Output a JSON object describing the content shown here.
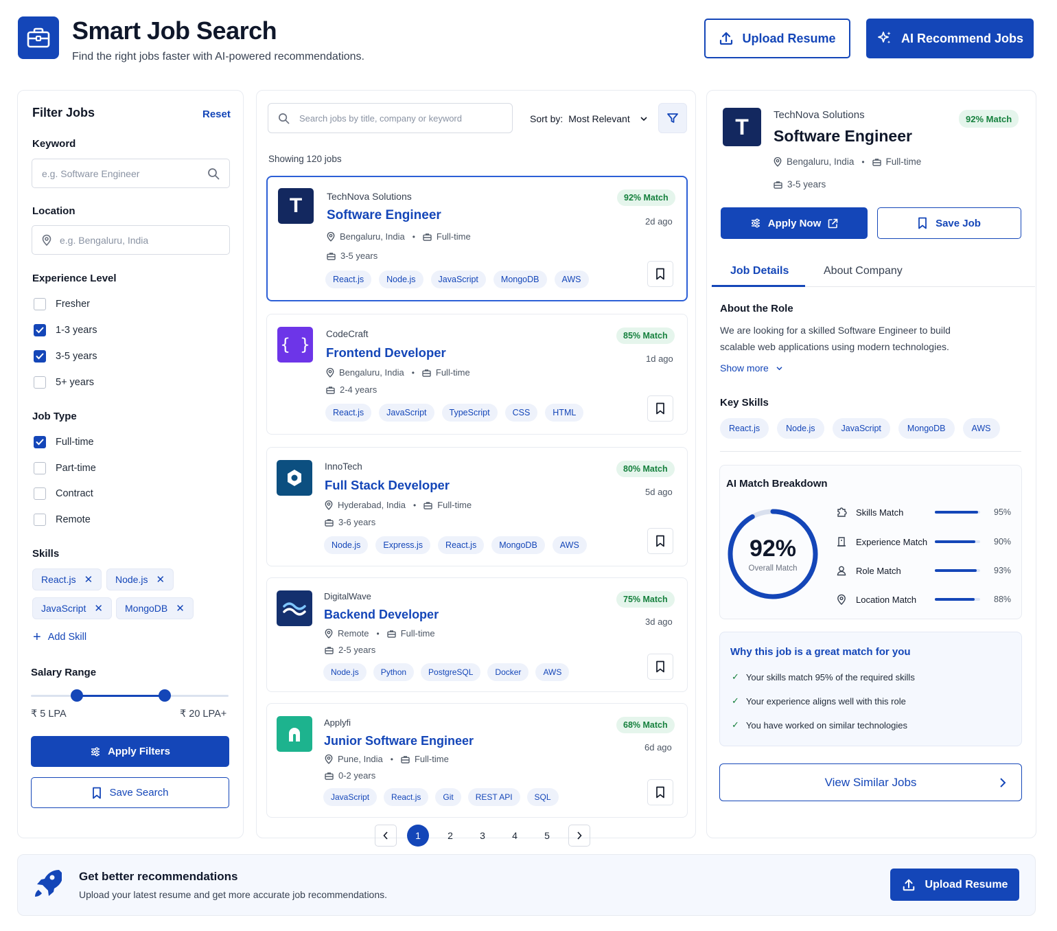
{
  "header": {
    "title": "Smart Job Search",
    "subtitle": "Find the right jobs faster with AI-powered recommendations.",
    "upload_resume": "Upload Resume",
    "ai_recommend": "AI Recommend Jobs"
  },
  "filters": {
    "title": "Filter Jobs",
    "reset": "Reset",
    "keyword_label": "Keyword",
    "keyword_placeholder": "e.g. Software Engineer",
    "location_label": "Location",
    "location_placeholder": "e.g. Bengaluru, India",
    "experience_label": "Experience Level",
    "experience": [
      {
        "label": "Fresher",
        "checked": false
      },
      {
        "label": "1-3 years",
        "checked": true
      },
      {
        "label": "3-5 years",
        "checked": true
      },
      {
        "label": "5+ years",
        "checked": false
      }
    ],
    "jobtype_label": "Job Type",
    "jobtype": [
      {
        "label": "Full-time",
        "checked": true
      },
      {
        "label": "Part-time",
        "checked": false
      },
      {
        "label": "Contract",
        "checked": false
      },
      {
        "label": "Remote",
        "checked": false
      }
    ],
    "skills_label": "Skills",
    "skills": [
      "React.js",
      "Node.js",
      "JavaScript",
      "MongoDB"
    ],
    "add_skill": "Add Skill",
    "salary_label": "Salary Range",
    "salary_min": "₹ 5 LPA",
    "salary_max": "₹ 20 LPA+",
    "apply_filters": "Apply Filters",
    "save_search": "Save Search"
  },
  "list": {
    "search_placeholder": "Search jobs by title, company or keyword",
    "sort_label": "Sort by:",
    "sort_value": "Most Relevant",
    "showing": "Showing 120 jobs",
    "jobs": [
      {
        "company": "TechNova Solutions",
        "title": "Software Engineer",
        "location": "Bengaluru, India",
        "type": "Full-time",
        "exp": "3-5 years",
        "match": "92% Match",
        "ago": "2d ago",
        "tags": [
          "React.js",
          "Node.js",
          "JavaScript",
          "MongoDB",
          "AWS"
        ],
        "logo": "T",
        "logo_color": "#13285f"
      },
      {
        "company": "CodeCraft",
        "title": "Frontend Developer",
        "location": "Bengaluru, India",
        "type": "Full-time",
        "exp": "2-4 years",
        "match": "85% Match",
        "ago": "1d ago",
        "tags": [
          "React.js",
          "JavaScript",
          "TypeScript",
          "CSS",
          "HTML"
        ],
        "logo": "{ }",
        "logo_color": "#6d35e8"
      },
      {
        "company": "InnoTech",
        "title": "Full Stack Developer",
        "location": "Hyderabad, India",
        "type": "Full-time",
        "exp": "3-6 years",
        "match": "80% Match",
        "ago": "5d ago",
        "tags": [
          "Node.js",
          "Express.js",
          "React.js",
          "MongoDB",
          "AWS"
        ],
        "logo": "hex-icon",
        "logo_color": "#0c4f80"
      },
      {
        "company": "DigitalWave",
        "title": "Backend Developer",
        "location": "Remote",
        "type": "Full-time",
        "exp": "2-5 years",
        "match": "75% Match",
        "ago": "3d ago",
        "tags": [
          "Node.js",
          "Python",
          "PostgreSQL",
          "Docker",
          "AWS"
        ],
        "logo": "wave-icon",
        "logo_color": "#14306e"
      },
      {
        "company": "Applyfi",
        "title": "Junior Software Engineer",
        "location": "Pune, India",
        "type": "Full-time",
        "exp": "0-2 years",
        "match": "68% Match",
        "ago": "6d ago",
        "tags": [
          "JavaScript",
          "React.js",
          "Git",
          "REST API",
          "SQL"
        ],
        "logo": "arch-icon",
        "logo_color": "#1db38e"
      }
    ],
    "pages": [
      "1",
      "2",
      "3",
      "4",
      "5"
    ],
    "current_page": "1"
  },
  "detail": {
    "company": "TechNova Solutions",
    "title": "Software Engineer",
    "match": "92% Match",
    "location": "Bengaluru, India",
    "type": "Full-time",
    "exp": "3-5 years",
    "logo": "T",
    "apply_now": "Apply Now",
    "save_job": "Save Job",
    "tabs": [
      "Job Details",
      "About Company"
    ],
    "about_heading": "About the Role",
    "about_text_1": "We are looking for a skilled Software Engineer to build",
    "about_text_2": "scalable web applications using modern technologies.",
    "show_more": "Show more",
    "key_skills_heading": "Key Skills",
    "key_skills": [
      "React.js",
      "Node.js",
      "JavaScript",
      "MongoDB",
      "AWS"
    ],
    "breakdown_heading": "AI Match Breakdown",
    "overall_value": "92%",
    "overall_fraction": 0.92,
    "overall_label": "Overall Match",
    "breakdown": [
      {
        "label": "Skills Match",
        "value": "95%",
        "fraction": 0.95,
        "icon": "puzzle-icon"
      },
      {
        "label": "Experience Match",
        "value": "90%",
        "fraction": 0.9,
        "icon": "briefcase-icon"
      },
      {
        "label": "Role Match",
        "value": "93%",
        "fraction": 0.93,
        "icon": "user-icon"
      },
      {
        "label": "Location Match",
        "value": "88%",
        "fraction": 0.88,
        "icon": "pin-icon"
      }
    ],
    "why_heading": "Why this job is a great match for you",
    "why": [
      "Your skills match 95% of the required skills",
      "Your experience aligns well with this role",
      "You have worked on similar technologies"
    ],
    "view_similar": "View Similar Jobs"
  },
  "banner": {
    "title": "Get better recommendations",
    "text": "Upload your latest resume and get more accurate job recommendations.",
    "button": "Upload Resume"
  },
  "colors": {
    "primary": "#1446b8",
    "match_bg": "#e5f5ec",
    "match_text": "#15803d"
  }
}
